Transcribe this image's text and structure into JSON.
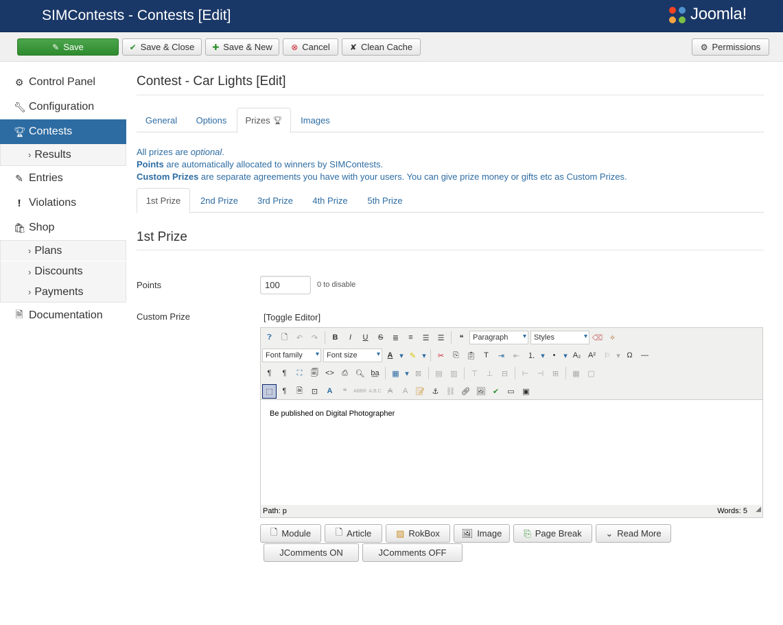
{
  "header": {
    "title": "SIMContests - Contests [Edit]",
    "logo_text": "Joomla!"
  },
  "toolbar": {
    "save": "Save",
    "save_close": "Save & Close",
    "save_new": "Save & New",
    "cancel": "Cancel",
    "clean_cache": "Clean Cache",
    "permissions": "Permissions"
  },
  "sidebar": {
    "control_panel": "Control Panel",
    "configuration": "Configuration",
    "contests": "Contests",
    "results": "Results",
    "entries": "Entries",
    "violations": "Violations",
    "shop": "Shop",
    "plans": "Plans",
    "discounts": "Discounts",
    "payments": "Payments",
    "documentation": "Documentation"
  },
  "main": {
    "title": "Contest - Car Lights [Edit]",
    "tabs": [
      "General",
      "Options",
      "Prizes",
      "Images"
    ],
    "active_tab": "Prizes",
    "info": {
      "line1_prefix": "All prizes are ",
      "line1_em": "optional",
      "line1_suffix": ".",
      "line2_bold": "Points",
      "line2_rest": " are automatically allocated to winners by SIMContests.",
      "line3_bold": "Custom Prizes",
      "line3_rest": " are separate agreements you have with your users. You can give prize money or gifts etc as Custom Prizes."
    },
    "prize_tabs": [
      "1st Prize",
      "2nd Prize",
      "3rd Prize",
      "4th Prize",
      "5th Prize"
    ],
    "section_title": "1st Prize",
    "points_label": "Points",
    "points_value": "100",
    "points_hint": "0 to disable",
    "custom_prize_label": "Custom Prize",
    "toggle_editor": "[Toggle Editor]"
  },
  "editor": {
    "format_select": "Paragraph",
    "styles_select": "Styles",
    "font_family": "Font family",
    "font_size": "Font size",
    "content": "Be published on Digital Photographer",
    "path": "Path:  p",
    "words": "Words: 5"
  },
  "editor_buttons": {
    "module": "Module",
    "article": "Article",
    "rokbox": "RokBox",
    "image": "Image",
    "page_break": "Page Break",
    "read_more": "Read More",
    "jcomments_on": "JComments ON",
    "jcomments_off": "JComments OFF"
  }
}
